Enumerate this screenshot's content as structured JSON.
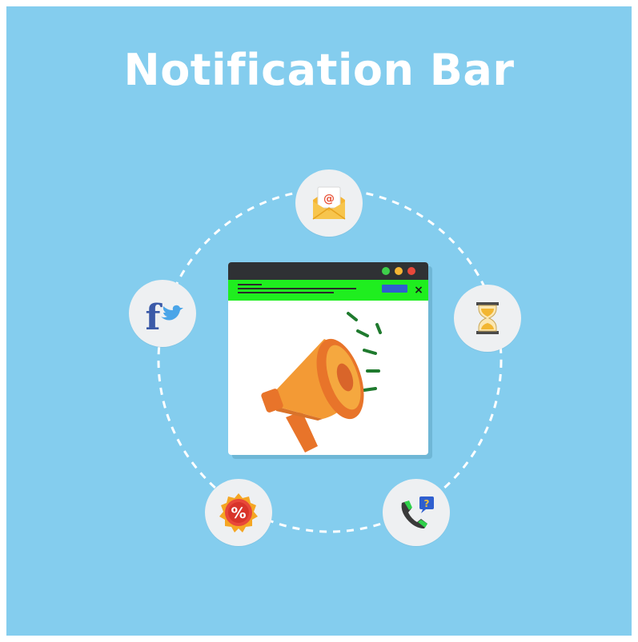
{
  "title": "Notification Bar",
  "colors": {
    "background": "#84cdee",
    "title_text": "#ffffff",
    "node_bg": "#eef0f2",
    "notification_bar": "#1fee1f",
    "window_titlebar": "#2f3134",
    "megaphone": "#f08a2a",
    "accent_blue": "#2f5fcf"
  },
  "icons": {
    "center": "megaphone-icon",
    "top": "email-icon",
    "right": "hourglass-icon",
    "bottom_right": "phone-support-icon",
    "bottom_left": "discount-badge-icon",
    "left": "social-icon"
  },
  "email_glyph": "@",
  "discount_glyph": "%",
  "support_glyph": "?",
  "facebook_glyph": "f",
  "close_glyph": "×"
}
